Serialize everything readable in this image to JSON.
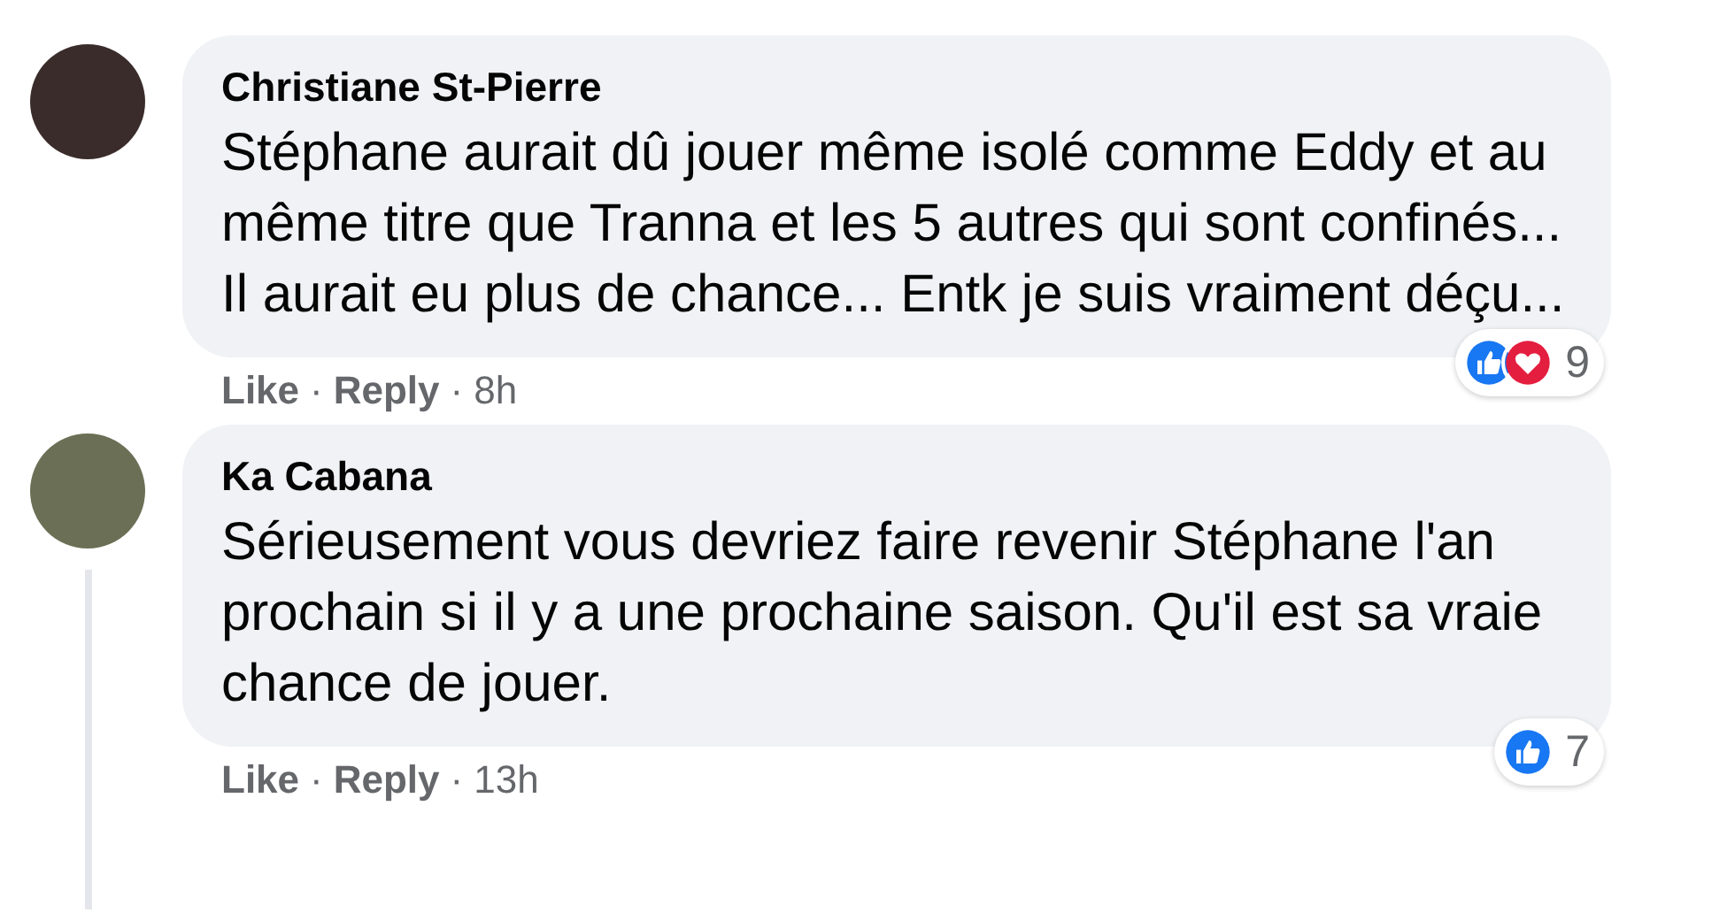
{
  "comments": [
    {
      "author": "Christiane St-Pierre",
      "text": "Stéphane aurait dû jouer même isolé comme Eddy et au même titre que Tranna et les 5 autres qui sont confinés... Il aurait eu plus de chance... Entk je suis vraiment déçu...",
      "actions": [
        "Like",
        "Reply"
      ],
      "separator": "·",
      "time": "8h",
      "reactions": [
        {
          "kind": "like"
        },
        {
          "kind": "love"
        }
      ],
      "reaction_count": "9",
      "thread_line": false
    },
    {
      "author": "Ka Cabana",
      "text": "Sérieusement vous devriez faire revenir Stéphane l'an prochain si il y a une prochaine saison. Qu'il est sa vraie chance de jouer.",
      "actions": [
        "Like",
        "Reply"
      ],
      "separator": "·",
      "time": "13h",
      "reactions": [
        {
          "kind": "like"
        }
      ],
      "reaction_count": "7",
      "thread_line": true
    }
  ]
}
